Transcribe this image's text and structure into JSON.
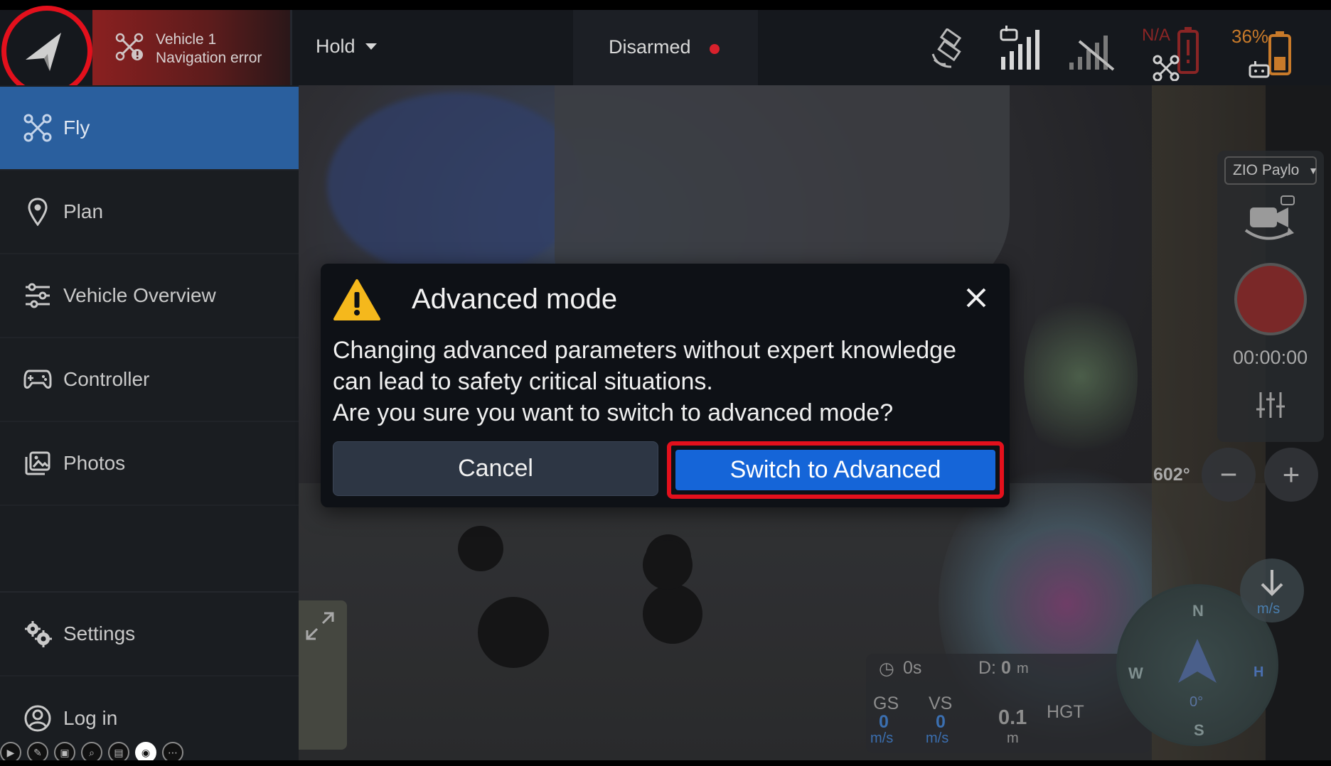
{
  "topbar": {
    "vehicle_name": "Vehicle 1",
    "vehicle_status": "Navigation error",
    "flight_mode": "Hold",
    "arm_state": "Disarmed",
    "remote_id_text": "N/A",
    "battery_percent": "36%",
    "colors": {
      "error": "#8a2020",
      "arm_dot": "#d8212c",
      "battery": "#c87a2a"
    }
  },
  "sidebar": {
    "items": [
      {
        "label": "Fly",
        "icon": "drone-icon",
        "active": true
      },
      {
        "label": "Plan",
        "icon": "map-pin-icon"
      },
      {
        "label": "Vehicle Overview",
        "icon": "sliders-icon"
      },
      {
        "label": "Controller",
        "icon": "gamepad-icon"
      },
      {
        "label": "Photos",
        "icon": "photos-icon"
      }
    ],
    "settings_label": "Settings",
    "login_label": "Log in",
    "accent": "#2a5f9e"
  },
  "camera_panel": {
    "payload_label": "ZIO Paylo",
    "record_time": "00:00:00",
    "zoom_value": "602°"
  },
  "telemetry": {
    "time": "0s",
    "distance_label": "D:",
    "distance_value": "0",
    "distance_unit": "m",
    "gs_label": "GS",
    "gs_value": "0",
    "gs_unit": "m/s",
    "vs_label": "VS",
    "vs_value": "0",
    "vs_unit": "m/s",
    "hgt_value": "0.1",
    "hgt_unit": "m",
    "hgt_label": "HGT",
    "descend_unit": "m/s"
  },
  "compass": {
    "n": "N",
    "s": "S",
    "w": "W",
    "heading": "0°",
    "home": "H"
  },
  "dialog": {
    "title": "Advanced mode",
    "body_line1": "Changing advanced parameters without expert knowledge",
    "body_line2": "can lead to safety critical situations.",
    "body_line3": "Are you sure you want to switch to advanced mode?",
    "cancel_label": "Cancel",
    "confirm_label": "Switch to Advanced",
    "colors": {
      "confirm": "#1565d8",
      "highlight": "#e3101c",
      "warning": "#f5b81c"
    }
  }
}
